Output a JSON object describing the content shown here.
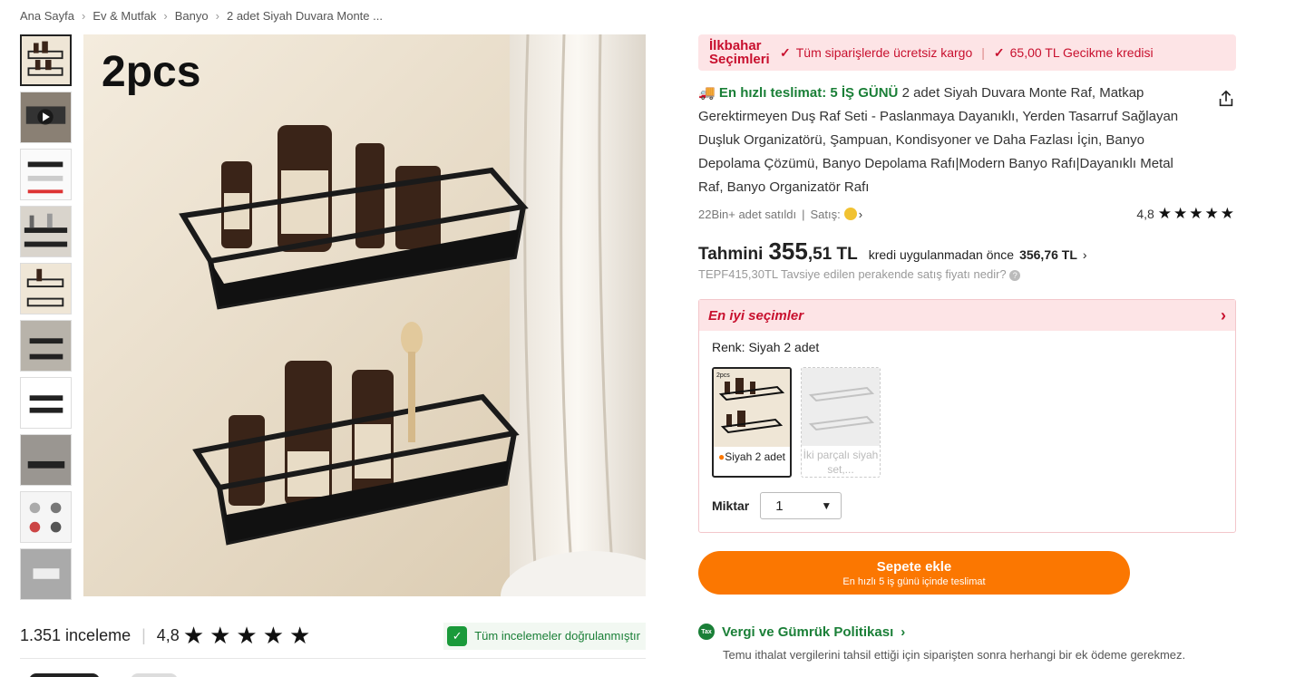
{
  "breadcrumb": {
    "items": [
      "Ana Sayfa",
      "Ev & Mutfak",
      "Banyo",
      "2 adet Siyah Duvara Monte ..."
    ]
  },
  "gallery": {
    "main_label": "2pcs",
    "thumbnails": [
      "thumb-1",
      "thumb-2-video",
      "thumb-3",
      "thumb-4",
      "thumb-5",
      "thumb-6",
      "thumb-7",
      "thumb-8",
      "thumb-9",
      "thumb-10"
    ]
  },
  "reviews": {
    "count": "1.351 inceleme",
    "score": "4,8",
    "stars": "★★★★★",
    "verified": "Tüm incelemeler doğrulanmıştır"
  },
  "promo": {
    "title": "İlkbahar Seçimleri",
    "item1": "Tüm siparişlerde ücretsiz kargo",
    "item2": "65,00 TL Gecikme kredisi",
    "color": "#c8102e"
  },
  "product": {
    "fast_delivery": "En hızlı teslimat: 5 İŞ GÜNÜ",
    "title": "2 adet Siyah Duvara Monte Raf, Matkap Gerektirmeyen Duş Raf Seti - Paslanmaya Dayanıklı, Yerden Tasarruf Sağlayan Duşluk Organizatörü, Şampuan, Kondisyoner ve Daha Fazlası İçin, Banyo Depolama Çözümü, Banyo Depolama Rafı|Modern Banyo Rafı|Dayanıklı Metal Raf, Banyo Organizatör Rafı",
    "sold": "22Bin+ adet satıldı",
    "seller_label": "Satış:",
    "rating": "4,8",
    "stars": "★★★★★"
  },
  "price": {
    "prefix": "Tahmini",
    "main": "355",
    "cents": ",51 TL",
    "note": "kredi uygulanmadan önce",
    "original": "356,76 TL",
    "rrp": "TEPF415,30TL Tavsiye edilen perakende satış fiyatı nedir?"
  },
  "options": {
    "header": "En iyi seçimler",
    "color_label": "Renk: Siyah 2 adet",
    "swatches": [
      {
        "label": "Siyah 2 adet",
        "tag": "2pcs"
      },
      {
        "label": "İki parçalı siyah set,..."
      }
    ],
    "quantity_label": "Miktar",
    "quantity_value": "1"
  },
  "cart": {
    "label": "Sepete ekle",
    "sub": "En hızlı 5 iş günü içinde teslimat",
    "color": "#fb7701"
  },
  "tax": {
    "badge": "Tax",
    "title": "Vergi ve Gümrük Politikası",
    "note": "Temu ithalat vergilerini tahsil ettiği için siparişten sonra herhangi bir ek ödeme gerekmez."
  }
}
